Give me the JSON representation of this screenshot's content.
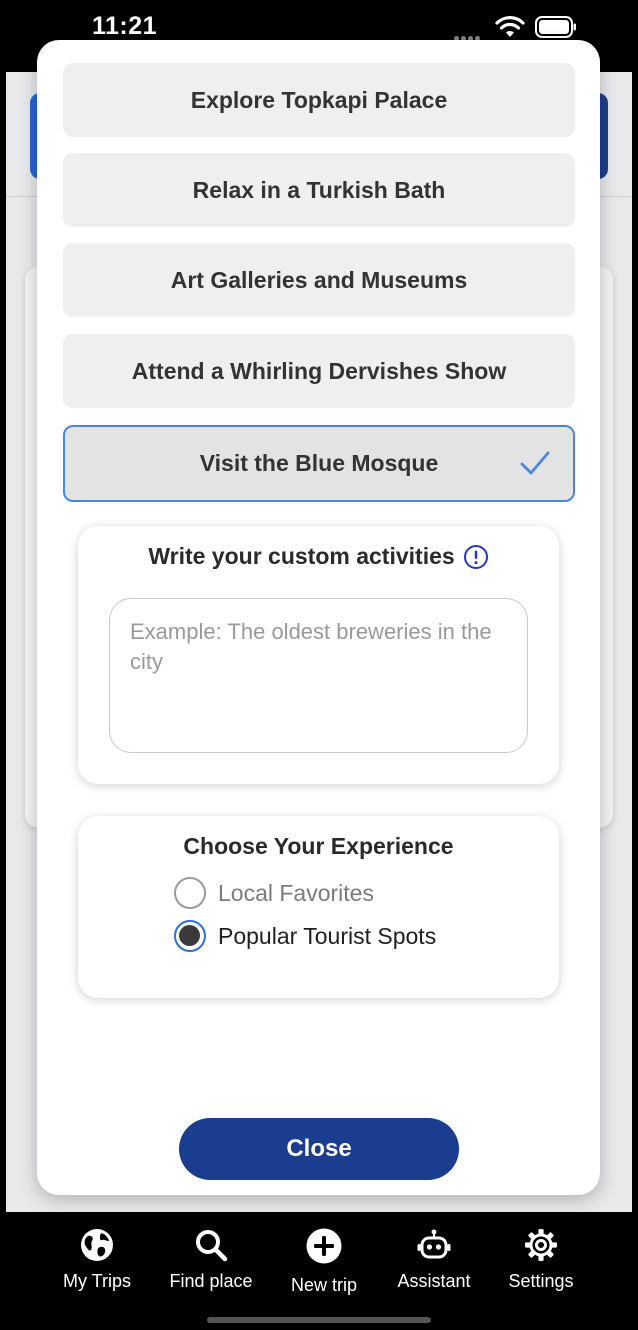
{
  "status_bar": {
    "time": "11:21"
  },
  "activities": [
    {
      "label": "Explore Topkapi Palace",
      "selected": false
    },
    {
      "label": "Relax in a Turkish Bath",
      "selected": false
    },
    {
      "label": "Art Galleries and Museums",
      "selected": false
    },
    {
      "label": "Attend a Whirling Dervishes Show",
      "selected": false
    },
    {
      "label": "Visit the Blue Mosque",
      "selected": true
    }
  ],
  "custom_activities": {
    "title": "Write your custom activities",
    "placeholder": "Example: The oldest breweries in the city",
    "value": ""
  },
  "experience": {
    "title": "Choose Your Experience",
    "options": [
      {
        "label": "Local Favorites",
        "selected": false
      },
      {
        "label": "Popular Tourist Spots",
        "selected": true
      }
    ]
  },
  "close_button": {
    "label": "Close"
  },
  "tab_bar": {
    "tabs": [
      {
        "label": "My Trips",
        "icon": "globe-icon"
      },
      {
        "label": "Find place",
        "icon": "search-icon"
      },
      {
        "label": "New trip",
        "icon": "plus-circle-icon"
      },
      {
        "label": "Assistant",
        "icon": "robot-icon"
      },
      {
        "label": "Settings",
        "icon": "gear-icon"
      }
    ]
  },
  "colors": {
    "primary": "#1b3d8f",
    "accent": "#4a86e0",
    "info": "#2235c7"
  }
}
